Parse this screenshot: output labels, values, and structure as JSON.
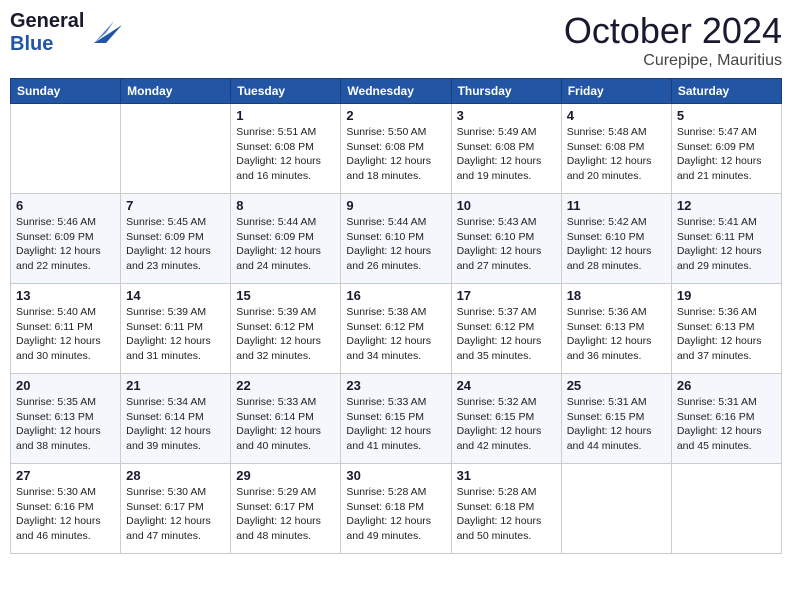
{
  "header": {
    "logo_line1": "General",
    "logo_line2": "Blue",
    "month": "October 2024",
    "location": "Curepipe, Mauritius"
  },
  "days_of_week": [
    "Sunday",
    "Monday",
    "Tuesday",
    "Wednesday",
    "Thursday",
    "Friday",
    "Saturday"
  ],
  "weeks": [
    [
      {
        "day": "",
        "sunrise": "",
        "sunset": "",
        "daylight": ""
      },
      {
        "day": "",
        "sunrise": "",
        "sunset": "",
        "daylight": ""
      },
      {
        "day": "1",
        "sunrise": "Sunrise: 5:51 AM",
        "sunset": "Sunset: 6:08 PM",
        "daylight": "Daylight: 12 hours and 16 minutes."
      },
      {
        "day": "2",
        "sunrise": "Sunrise: 5:50 AM",
        "sunset": "Sunset: 6:08 PM",
        "daylight": "Daylight: 12 hours and 18 minutes."
      },
      {
        "day": "3",
        "sunrise": "Sunrise: 5:49 AM",
        "sunset": "Sunset: 6:08 PM",
        "daylight": "Daylight: 12 hours and 19 minutes."
      },
      {
        "day": "4",
        "sunrise": "Sunrise: 5:48 AM",
        "sunset": "Sunset: 6:08 PM",
        "daylight": "Daylight: 12 hours and 20 minutes."
      },
      {
        "day": "5",
        "sunrise": "Sunrise: 5:47 AM",
        "sunset": "Sunset: 6:09 PM",
        "daylight": "Daylight: 12 hours and 21 minutes."
      }
    ],
    [
      {
        "day": "6",
        "sunrise": "Sunrise: 5:46 AM",
        "sunset": "Sunset: 6:09 PM",
        "daylight": "Daylight: 12 hours and 22 minutes."
      },
      {
        "day": "7",
        "sunrise": "Sunrise: 5:45 AM",
        "sunset": "Sunset: 6:09 PM",
        "daylight": "Daylight: 12 hours and 23 minutes."
      },
      {
        "day": "8",
        "sunrise": "Sunrise: 5:44 AM",
        "sunset": "Sunset: 6:09 PM",
        "daylight": "Daylight: 12 hours and 24 minutes."
      },
      {
        "day": "9",
        "sunrise": "Sunrise: 5:44 AM",
        "sunset": "Sunset: 6:10 PM",
        "daylight": "Daylight: 12 hours and 26 minutes."
      },
      {
        "day": "10",
        "sunrise": "Sunrise: 5:43 AM",
        "sunset": "Sunset: 6:10 PM",
        "daylight": "Daylight: 12 hours and 27 minutes."
      },
      {
        "day": "11",
        "sunrise": "Sunrise: 5:42 AM",
        "sunset": "Sunset: 6:10 PM",
        "daylight": "Daylight: 12 hours and 28 minutes."
      },
      {
        "day": "12",
        "sunrise": "Sunrise: 5:41 AM",
        "sunset": "Sunset: 6:11 PM",
        "daylight": "Daylight: 12 hours and 29 minutes."
      }
    ],
    [
      {
        "day": "13",
        "sunrise": "Sunrise: 5:40 AM",
        "sunset": "Sunset: 6:11 PM",
        "daylight": "Daylight: 12 hours and 30 minutes."
      },
      {
        "day": "14",
        "sunrise": "Sunrise: 5:39 AM",
        "sunset": "Sunset: 6:11 PM",
        "daylight": "Daylight: 12 hours and 31 minutes."
      },
      {
        "day": "15",
        "sunrise": "Sunrise: 5:39 AM",
        "sunset": "Sunset: 6:12 PM",
        "daylight": "Daylight: 12 hours and 32 minutes."
      },
      {
        "day": "16",
        "sunrise": "Sunrise: 5:38 AM",
        "sunset": "Sunset: 6:12 PM",
        "daylight": "Daylight: 12 hours and 34 minutes."
      },
      {
        "day": "17",
        "sunrise": "Sunrise: 5:37 AM",
        "sunset": "Sunset: 6:12 PM",
        "daylight": "Daylight: 12 hours and 35 minutes."
      },
      {
        "day": "18",
        "sunrise": "Sunrise: 5:36 AM",
        "sunset": "Sunset: 6:13 PM",
        "daylight": "Daylight: 12 hours and 36 minutes."
      },
      {
        "day": "19",
        "sunrise": "Sunrise: 5:36 AM",
        "sunset": "Sunset: 6:13 PM",
        "daylight": "Daylight: 12 hours and 37 minutes."
      }
    ],
    [
      {
        "day": "20",
        "sunrise": "Sunrise: 5:35 AM",
        "sunset": "Sunset: 6:13 PM",
        "daylight": "Daylight: 12 hours and 38 minutes."
      },
      {
        "day": "21",
        "sunrise": "Sunrise: 5:34 AM",
        "sunset": "Sunset: 6:14 PM",
        "daylight": "Daylight: 12 hours and 39 minutes."
      },
      {
        "day": "22",
        "sunrise": "Sunrise: 5:33 AM",
        "sunset": "Sunset: 6:14 PM",
        "daylight": "Daylight: 12 hours and 40 minutes."
      },
      {
        "day": "23",
        "sunrise": "Sunrise: 5:33 AM",
        "sunset": "Sunset: 6:15 PM",
        "daylight": "Daylight: 12 hours and 41 minutes."
      },
      {
        "day": "24",
        "sunrise": "Sunrise: 5:32 AM",
        "sunset": "Sunset: 6:15 PM",
        "daylight": "Daylight: 12 hours and 42 minutes."
      },
      {
        "day": "25",
        "sunrise": "Sunrise: 5:31 AM",
        "sunset": "Sunset: 6:15 PM",
        "daylight": "Daylight: 12 hours and 44 minutes."
      },
      {
        "day": "26",
        "sunrise": "Sunrise: 5:31 AM",
        "sunset": "Sunset: 6:16 PM",
        "daylight": "Daylight: 12 hours and 45 minutes."
      }
    ],
    [
      {
        "day": "27",
        "sunrise": "Sunrise: 5:30 AM",
        "sunset": "Sunset: 6:16 PM",
        "daylight": "Daylight: 12 hours and 46 minutes."
      },
      {
        "day": "28",
        "sunrise": "Sunrise: 5:30 AM",
        "sunset": "Sunset: 6:17 PM",
        "daylight": "Daylight: 12 hours and 47 minutes."
      },
      {
        "day": "29",
        "sunrise": "Sunrise: 5:29 AM",
        "sunset": "Sunset: 6:17 PM",
        "daylight": "Daylight: 12 hours and 48 minutes."
      },
      {
        "day": "30",
        "sunrise": "Sunrise: 5:28 AM",
        "sunset": "Sunset: 6:18 PM",
        "daylight": "Daylight: 12 hours and 49 minutes."
      },
      {
        "day": "31",
        "sunrise": "Sunrise: 5:28 AM",
        "sunset": "Sunset: 6:18 PM",
        "daylight": "Daylight: 12 hours and 50 minutes."
      },
      {
        "day": "",
        "sunrise": "",
        "sunset": "",
        "daylight": ""
      },
      {
        "day": "",
        "sunrise": "",
        "sunset": "",
        "daylight": ""
      }
    ]
  ]
}
